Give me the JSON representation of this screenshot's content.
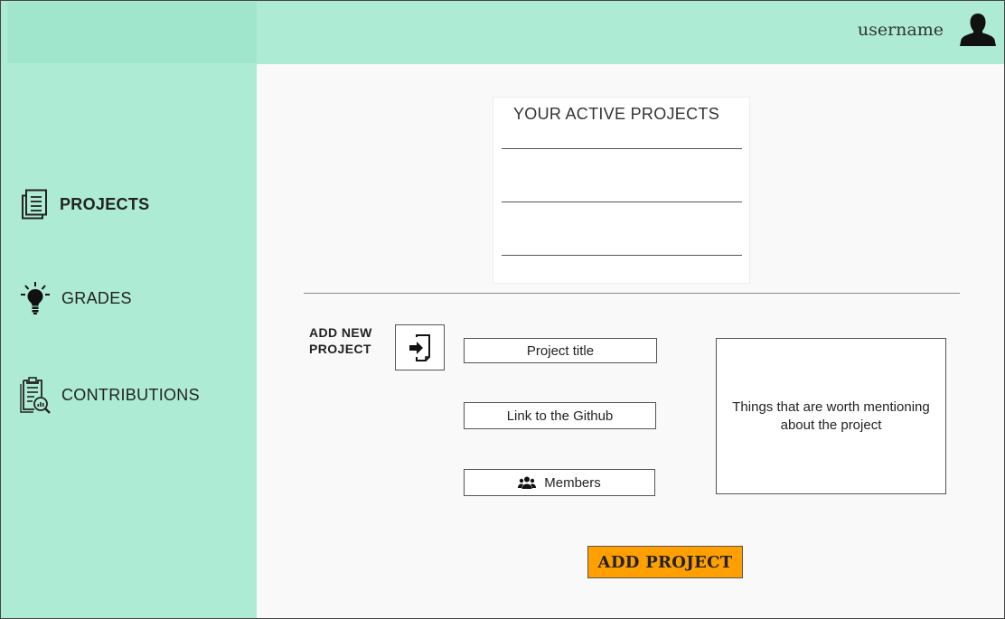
{
  "header": {
    "username": "username",
    "avatar_icon": "user-silhouette-icon"
  },
  "sidebar": {
    "items": [
      {
        "label": "PROJECTS",
        "icon": "documents-icon",
        "active": true
      },
      {
        "label": "GRADES",
        "icon": "lightbulb-icon",
        "active": false
      },
      {
        "label": "CONTRIBUTIONS",
        "icon": "clipboard-search-icon",
        "active": false
      }
    ]
  },
  "main": {
    "active_projects": {
      "title": "YOUR ACTIVE PROJECTS",
      "rows": [
        "",
        "",
        ""
      ]
    },
    "add_form": {
      "label": "ADD NEW PROJECT",
      "import_icon": "import-file-icon",
      "title_placeholder": "Project title",
      "github_placeholder": "Link to the Github",
      "members_label": "Members",
      "members_icon": "group-icon",
      "description_placeholder": "Things that are worth mentioning about the project",
      "submit_label": "ADD PROJECT"
    }
  },
  "colors": {
    "mint": "#aeebd5",
    "accent": "#ff9f00"
  }
}
